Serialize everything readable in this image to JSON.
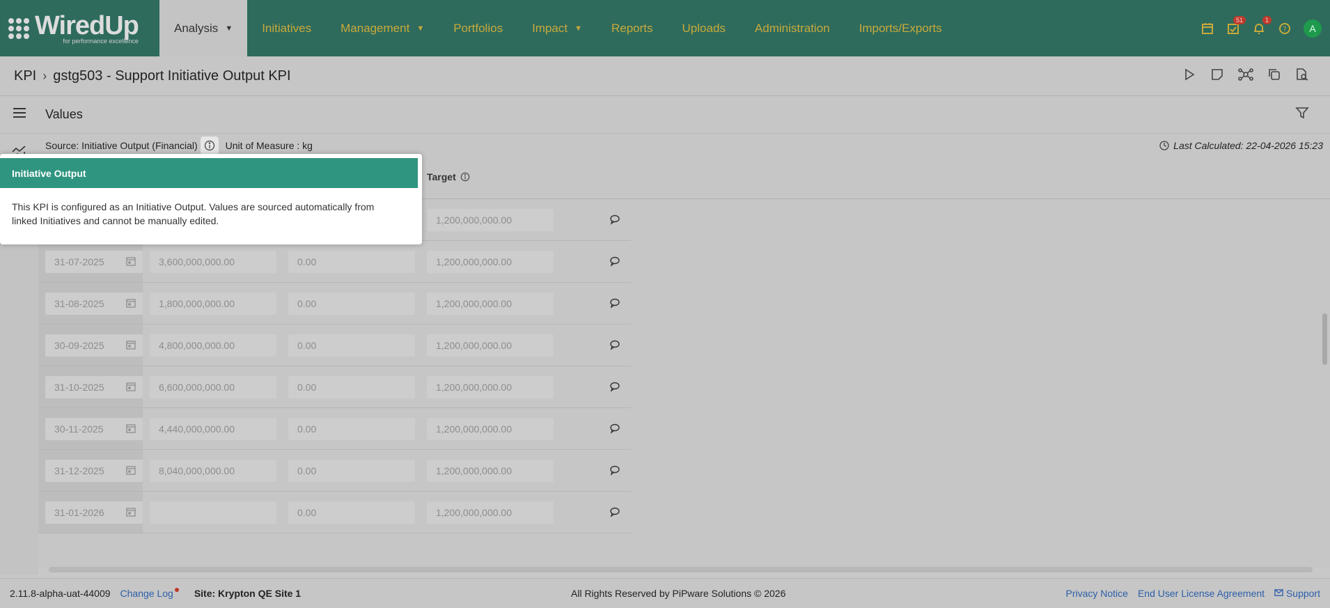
{
  "nav": {
    "logo_word": "WiredUp",
    "logo_tag": "for performance excellence",
    "items": [
      {
        "label": "Analysis",
        "caret": true,
        "active": true
      },
      {
        "label": "Initiatives",
        "caret": false
      },
      {
        "label": "Management",
        "caret": true
      },
      {
        "label": "Portfolios",
        "caret": false
      },
      {
        "label": "Impact",
        "caret": true
      },
      {
        "label": "Reports",
        "caret": false
      },
      {
        "label": "Uploads",
        "caret": false
      },
      {
        "label": "Administration",
        "caret": false
      },
      {
        "label": "Imports/Exports",
        "caret": false
      }
    ],
    "tasks_badge": "51",
    "alerts_badge": "1",
    "avatar": "A"
  },
  "breadcrumb": {
    "root": "KPI",
    "current": "gstg503 - Support Initiative Output KPI"
  },
  "section": {
    "title": "Values"
  },
  "source": {
    "source_text": "Source: Initiative Output (Financial)",
    "unit_text": "Unit of Measure : kg",
    "last_calculated": "Last Calculated: 22-04-2026 15:23"
  },
  "table": {
    "target_header": "Target",
    "rows": [
      {
        "date": "",
        "actual": "",
        "forecast": "",
        "target": "1,200,000,000.00"
      },
      {
        "date": "31-07-2025",
        "actual": "3,600,000,000.00",
        "forecast": "0.00",
        "target": "1,200,000,000.00"
      },
      {
        "date": "31-08-2025",
        "actual": "1,800,000,000.00",
        "forecast": "0.00",
        "target": "1,200,000,000.00"
      },
      {
        "date": "30-09-2025",
        "actual": "4,800,000,000.00",
        "forecast": "0.00",
        "target": "1,200,000,000.00"
      },
      {
        "date": "31-10-2025",
        "actual": "6,600,000,000.00",
        "forecast": "0.00",
        "target": "1,200,000,000.00"
      },
      {
        "date": "30-11-2025",
        "actual": "4,440,000,000.00",
        "forecast": "0.00",
        "target": "1,200,000,000.00"
      },
      {
        "date": "31-12-2025",
        "actual": "8,040,000,000.00",
        "forecast": "0.00",
        "target": "1,200,000,000.00"
      },
      {
        "date": "31-01-2026",
        "actual": "",
        "forecast": "0.00",
        "target": "1,200,000,000.00"
      }
    ]
  },
  "popover": {
    "title": "Initiative Output",
    "body": "This KPI is configured as an Initiative Output. Values are sourced automatically from linked Initiatives and cannot be manually edited."
  },
  "footer": {
    "version": "2.11.8-alpha-uat-44009",
    "changelog": "Change Log",
    "site": "Site: Krypton QE Site 1",
    "copyright": "All Rights Reserved by PiPware Solutions © 2026",
    "privacy": "Privacy Notice",
    "eula": "End User License Agreement",
    "support": "Support"
  },
  "colors": {
    "nav_bg": "#2e6b5d",
    "nav_text": "#c9a93a",
    "popover_head": "#2f9580",
    "link": "#2c5fa8"
  }
}
